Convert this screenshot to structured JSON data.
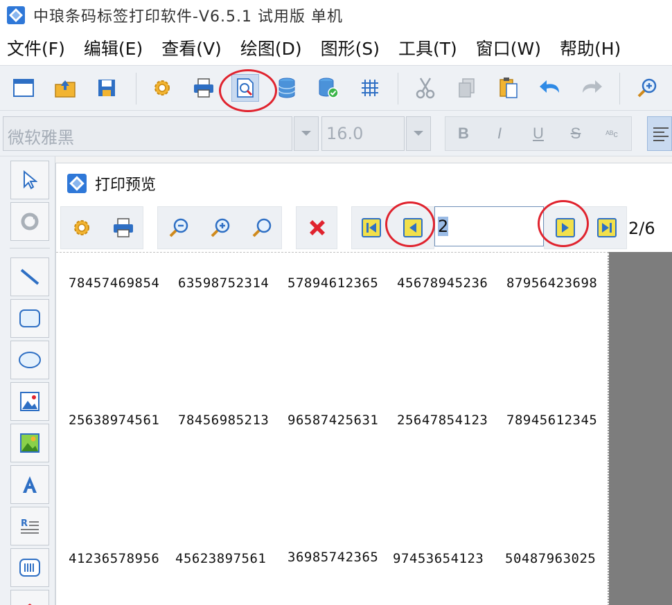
{
  "app": {
    "title": "中琅条码标签打印软件-V6.5.1 试用版 单机"
  },
  "menu": {
    "items": [
      "文件(F)",
      "编辑(E)",
      "查看(V)",
      "绘图(D)",
      "图形(S)",
      "工具(T)",
      "窗口(W)",
      "帮助(H)"
    ]
  },
  "toolbar": {
    "icons": [
      "new-document-icon",
      "open-folder-icon",
      "save-icon",
      "settings-icon",
      "print-icon",
      "print-preview-icon",
      "database-icon",
      "database-connect-icon",
      "grid-icon",
      "cut-icon",
      "copy-icon",
      "paste-icon",
      "undo-icon",
      "redo-icon",
      "zoom-in-icon"
    ],
    "active": "print-preview-icon"
  },
  "fontbar": {
    "font_name": "微软雅黑",
    "font_size": "16.0",
    "bold": "B",
    "italic": "I",
    "underline": "U",
    "strike": "S",
    "special": "ᴬᴮc"
  },
  "preview": {
    "title": "打印预览",
    "current_page": "2",
    "page_count": "2/6",
    "rows": [
      [
        "78457469854",
        "63598752314",
        "57894612365",
        "45678945236",
        "87956423698"
      ],
      [
        "25638974561",
        "78456985213",
        "96587425631",
        "25647854123",
        "78945612345"
      ],
      [
        "41236578956",
        "45623897561",
        "36985742365",
        "97453654123",
        "50487963025"
      ]
    ]
  },
  "colors": {
    "highlight_circle": "#e0232e",
    "active_button": "#c9daf0",
    "canvas_background": "#7d7d7d"
  }
}
